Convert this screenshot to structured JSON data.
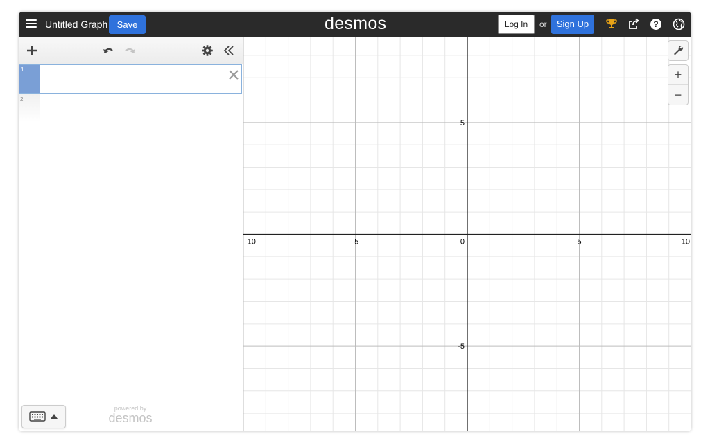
{
  "header": {
    "title": "Untitled Graph",
    "save_label": "Save",
    "brand": "desmos",
    "login_label": "Log In",
    "or_text": "or",
    "signup_label": "Sign Up",
    "icons": [
      "menu-icon",
      "trophy-icon",
      "share-icon",
      "help-icon",
      "globe-icon"
    ]
  },
  "expressions": {
    "toolbar_icons": [
      "add-icon",
      "undo-icon",
      "redo-icon",
      "settings-icon",
      "collapse-icon"
    ],
    "items": [
      {
        "number": "1",
        "value": ""
      },
      {
        "number": "2",
        "value": ""
      }
    ]
  },
  "powered_by": {
    "small": "powered by",
    "brand": "desmos"
  },
  "graph": {
    "x_ticks": [
      "-10",
      "-5",
      "0",
      "5",
      "10"
    ],
    "y_ticks": [
      "5",
      "-5"
    ],
    "x_range": [
      -10,
      10
    ],
    "y_range": [
      -8.8,
      8.8
    ],
    "zoom_in": "+",
    "zoom_out": "−"
  },
  "colors": {
    "header_bg": "#2a2a2a",
    "accent_blue": "#2f72dc",
    "active_tab": "#7a9fd6",
    "grid_minor": "#e6e6e6",
    "grid_major": "#bdbdbd",
    "axis": "#222222"
  }
}
